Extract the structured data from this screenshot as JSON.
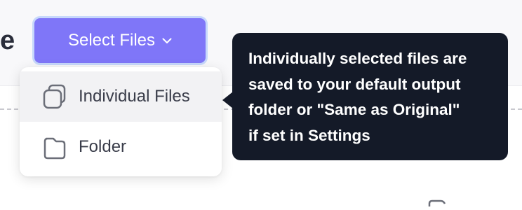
{
  "header": {
    "title_fragment": "e"
  },
  "select_button": {
    "label": "Select Files",
    "icon": "chevron-down-icon",
    "color": "#7f76f8"
  },
  "dropdown": {
    "items": [
      {
        "label": "Individual Files",
        "icon": "files-stack-icon",
        "hovered": true
      },
      {
        "label": "Folder",
        "icon": "folder-icon",
        "hovered": false
      }
    ]
  },
  "tooltip": {
    "lines": [
      "Individually selected files are",
      "saved to your default output",
      "folder or \"Same as Original\"",
      "if set in Settings"
    ],
    "background": "#141a28"
  }
}
